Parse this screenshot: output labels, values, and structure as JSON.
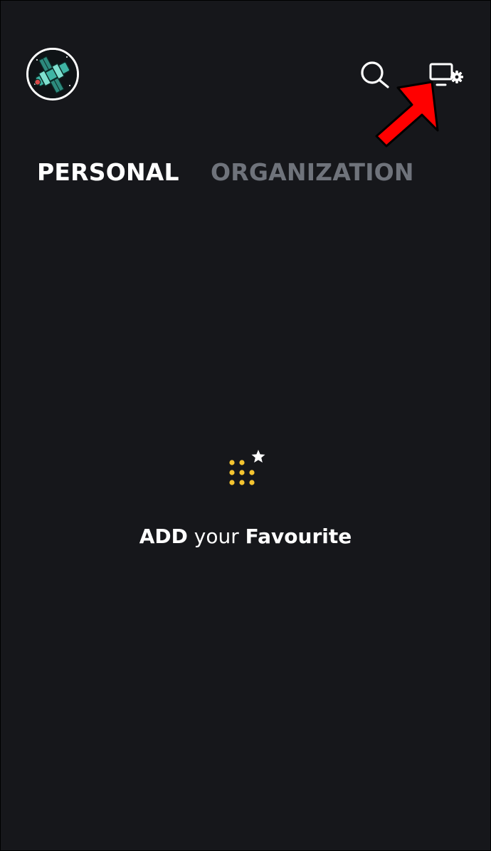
{
  "header": {
    "avatar_icon": "telescope-avatar-icon",
    "search_icon": "search-icon",
    "device_settings_icon": "device-settings-icon"
  },
  "tabs": [
    {
      "label": "PERSONAL",
      "active": true
    },
    {
      "label": "ORGANIZATION",
      "active": false
    }
  ],
  "empty_state": {
    "icon": "favourite-grid-star-icon",
    "text_part1": "ADD",
    "text_part2": " your ",
    "text_part3": "Favourite"
  },
  "colors": {
    "background": "#16171b",
    "active_tab": "#ffffff",
    "inactive_tab": "#6f737b",
    "accent_yellow": "#f4c430",
    "annotation_red": "#ff0000"
  }
}
